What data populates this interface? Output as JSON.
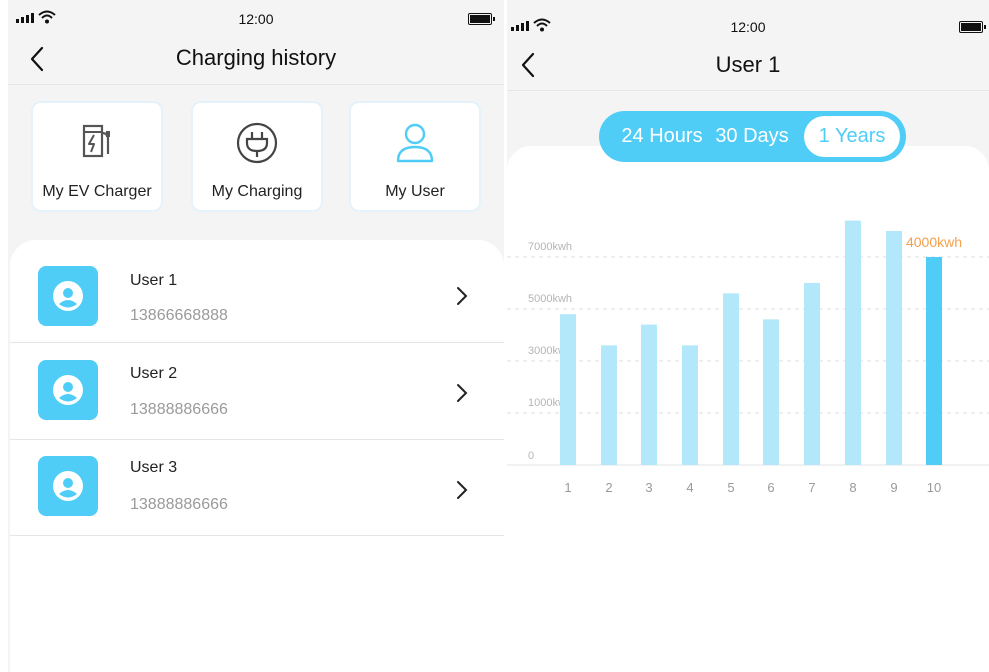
{
  "status": {
    "time": "12:00"
  },
  "left": {
    "title": "Charging history",
    "shortcuts": [
      {
        "label": "My EV Charger",
        "icon": "ev-charger-icon"
      },
      {
        "label": "My Charging",
        "icon": "plug-icon"
      },
      {
        "label": "My User",
        "icon": "user-icon"
      }
    ],
    "users": [
      {
        "name": "User 1",
        "phone": "13866668888"
      },
      {
        "name": "User 2",
        "phone": "13888886666"
      },
      {
        "name": "User 3",
        "phone": "13888886666"
      }
    ]
  },
  "right": {
    "title": "User 1",
    "tabs": [
      {
        "label": "24 Hours",
        "active": false
      },
      {
        "label": "30 Days",
        "active": false
      },
      {
        "label": "1 Years",
        "active": true
      }
    ]
  },
  "colors": {
    "accent": "#4fcdf7",
    "bar": "#b3e7fa",
    "bar_active": "#4fcdf7",
    "highlight_label": "#f5a04a"
  },
  "chart_data": {
    "type": "bar",
    "categories": [
      "1",
      "2",
      "3",
      "4",
      "5",
      "6",
      "7",
      "8",
      "9",
      "10"
    ],
    "values": [
      2900,
      2300,
      2700,
      2300,
      3300,
      2800,
      3500,
      4700,
      4500,
      4000
    ],
    "y_tick_labels": [
      "0",
      "1000kwh",
      "3000kwh",
      "5000kwh",
      "7000kwh"
    ],
    "highlight_index": 9,
    "highlight_label": "4000kwh",
    "grid": true
  }
}
